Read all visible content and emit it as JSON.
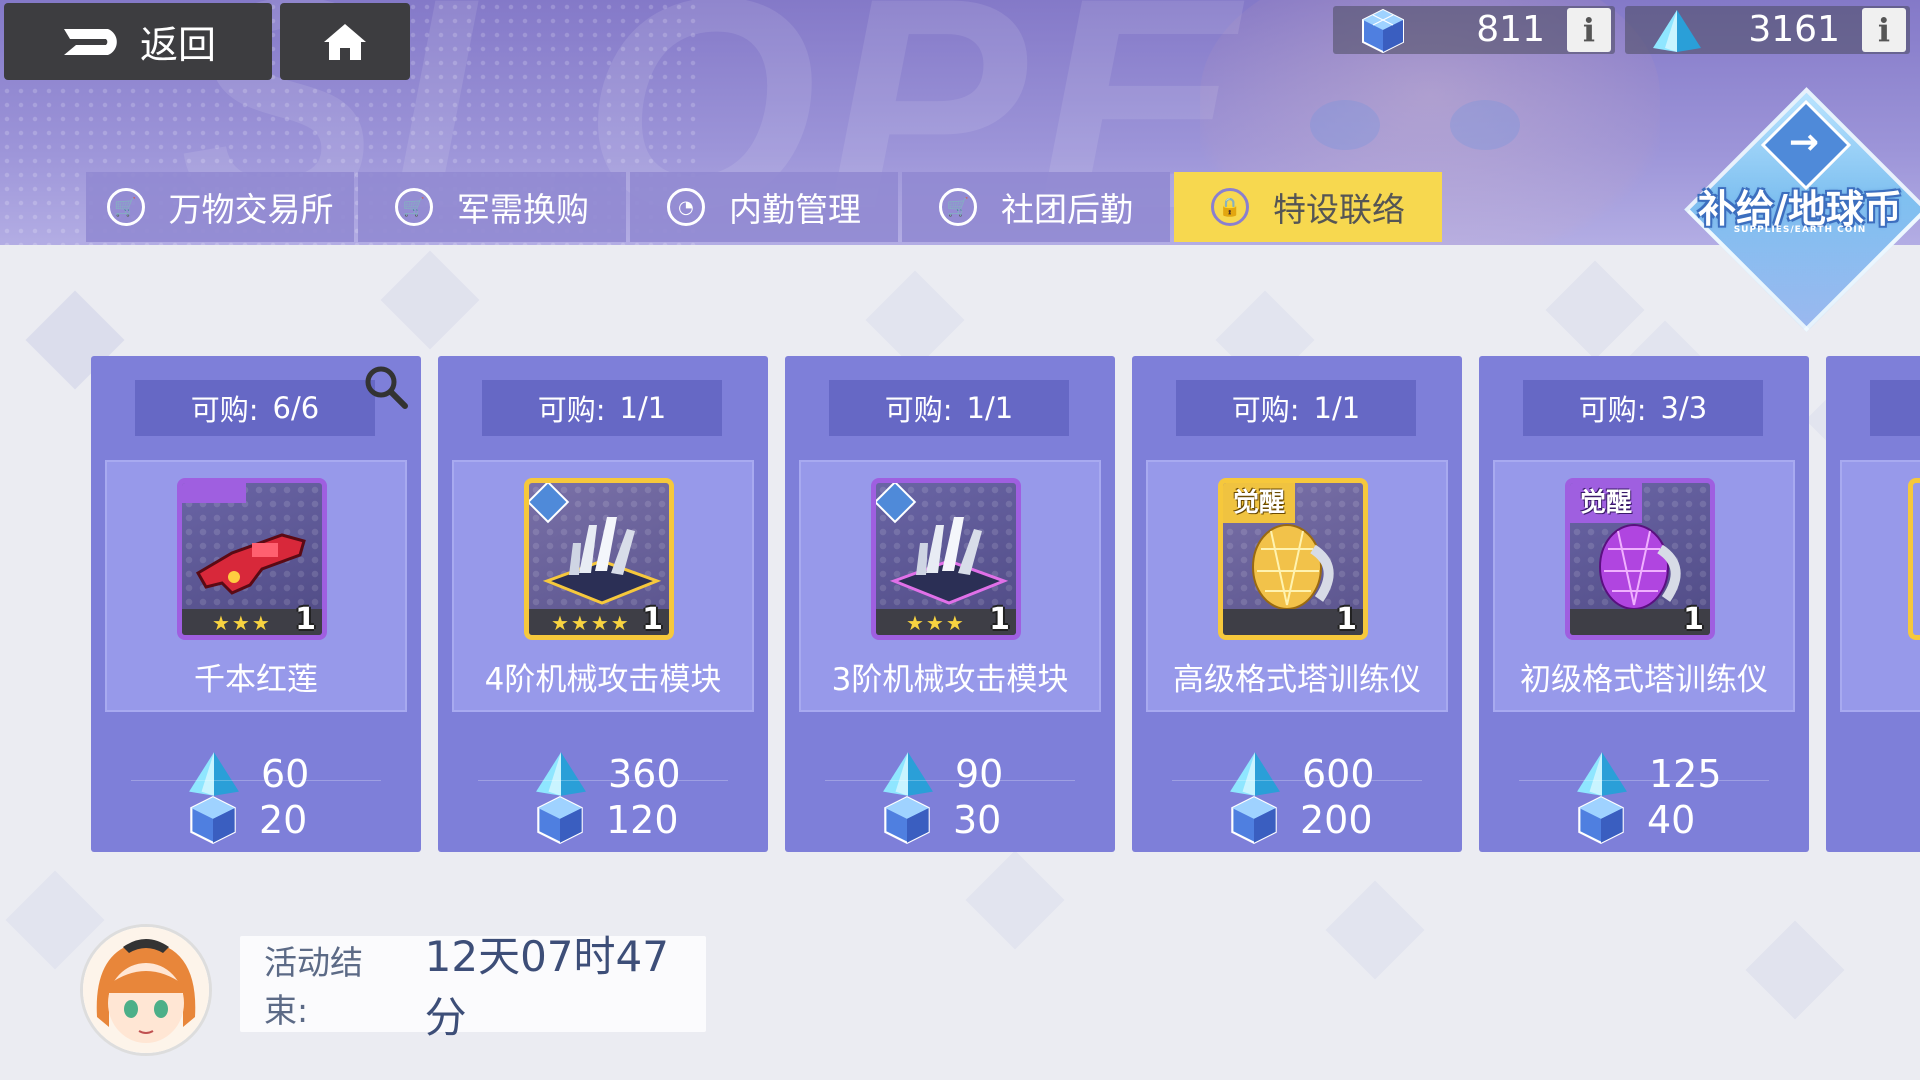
{
  "nav": {
    "back_label": "返回"
  },
  "currencies": [
    {
      "icon": "earth-coin-cube-icon",
      "value": "811"
    },
    {
      "icon": "crystal-pyramid-icon",
      "value": "3161"
    }
  ],
  "background_text": "SLOPE",
  "tabs": [
    {
      "label": "万物交易所",
      "icon": "cart-icon",
      "active": false
    },
    {
      "label": "军需换购",
      "icon": "cart-icon",
      "active": false
    },
    {
      "label": "内勤管理",
      "icon": "manage-icon",
      "active": false
    },
    {
      "label": "社团后勤",
      "icon": "cart-icon",
      "active": false
    },
    {
      "label": "特设联络",
      "icon": "lock-icon",
      "active": true
    }
  ],
  "supply_badge": {
    "title": "补给/地球币",
    "subtitle": "SUPPLIES/EARTH COIN"
  },
  "limit_prefix": "可购:",
  "shop_items": [
    {
      "limit": "6/6",
      "name": "千本红莲",
      "stars": "★★★",
      "qty": "1",
      "price_crystal": "60",
      "price_coin": "20",
      "frame": "purple",
      "art": "gun"
    },
    {
      "limit": "1/1",
      "name": "4阶机械攻击模块",
      "stars": "★★★★",
      "qty": "1",
      "price_crystal": "360",
      "price_coin": "120",
      "frame": "gold",
      "art": "module"
    },
    {
      "limit": "1/1",
      "name": "3阶机械攻击模块",
      "stars": "★★★",
      "qty": "1",
      "price_crystal": "90",
      "price_coin": "30",
      "frame": "purple",
      "art": "module"
    },
    {
      "limit": "1/1",
      "name": "高级格式塔训练仪",
      "stars": "",
      "qty": "1",
      "price_crystal": "600",
      "price_coin": "200",
      "frame": "gold",
      "art": "egg",
      "tag": "觉醒"
    },
    {
      "limit": "3/3",
      "name": "初级格式塔训练仪",
      "stars": "",
      "qty": "1",
      "price_crystal": "125",
      "price_coin": "40",
      "frame": "purple",
      "art": "egg",
      "tag": "觉醒"
    }
  ],
  "event": {
    "label": "活动结束:",
    "remaining": "12天07时47分"
  },
  "colors": {
    "accent_yellow": "#f7d84f",
    "card_bg": "#7e7fd9",
    "panel_bg": "#9799ea",
    "header_purple": "#8479c8"
  }
}
